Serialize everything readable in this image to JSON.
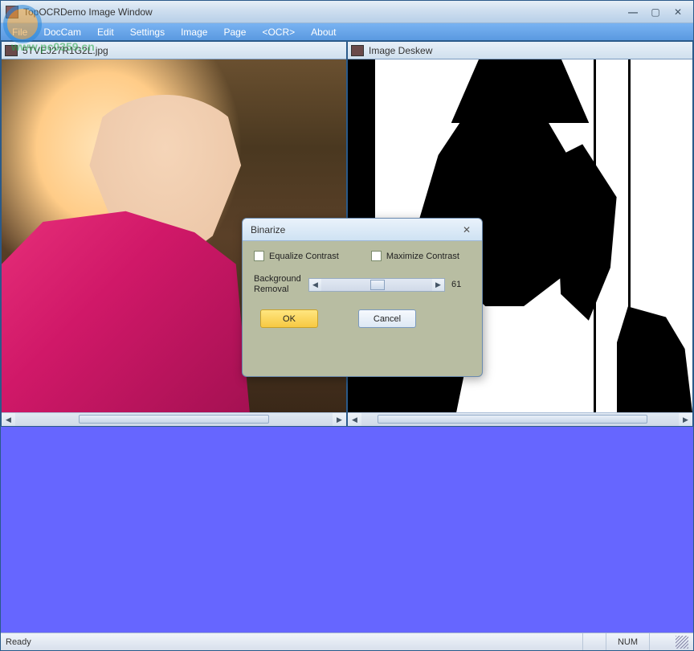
{
  "title": "TopOCRDemo Image Window",
  "menus": [
    "File",
    "DocCam",
    "Edit",
    "Settings",
    "Image",
    "Page",
    "<OCR>",
    "About"
  ],
  "left_pane": {
    "filename": "5TVEJ27R1G2L.jpg"
  },
  "right_pane": {
    "title": "Image Deskew"
  },
  "dialog": {
    "title": "Binarize",
    "equalize_label": "Equalize Contrast",
    "maximize_label": "Maximize Contrast",
    "bg_removal_label": "Background\nRemoval",
    "bg_removal_value": "61",
    "ok": "OK",
    "cancel": "Cancel"
  },
  "status": {
    "ready": "Ready",
    "num": "NUM"
  },
  "watermark": {
    "url": "www.pc0359.cn"
  }
}
